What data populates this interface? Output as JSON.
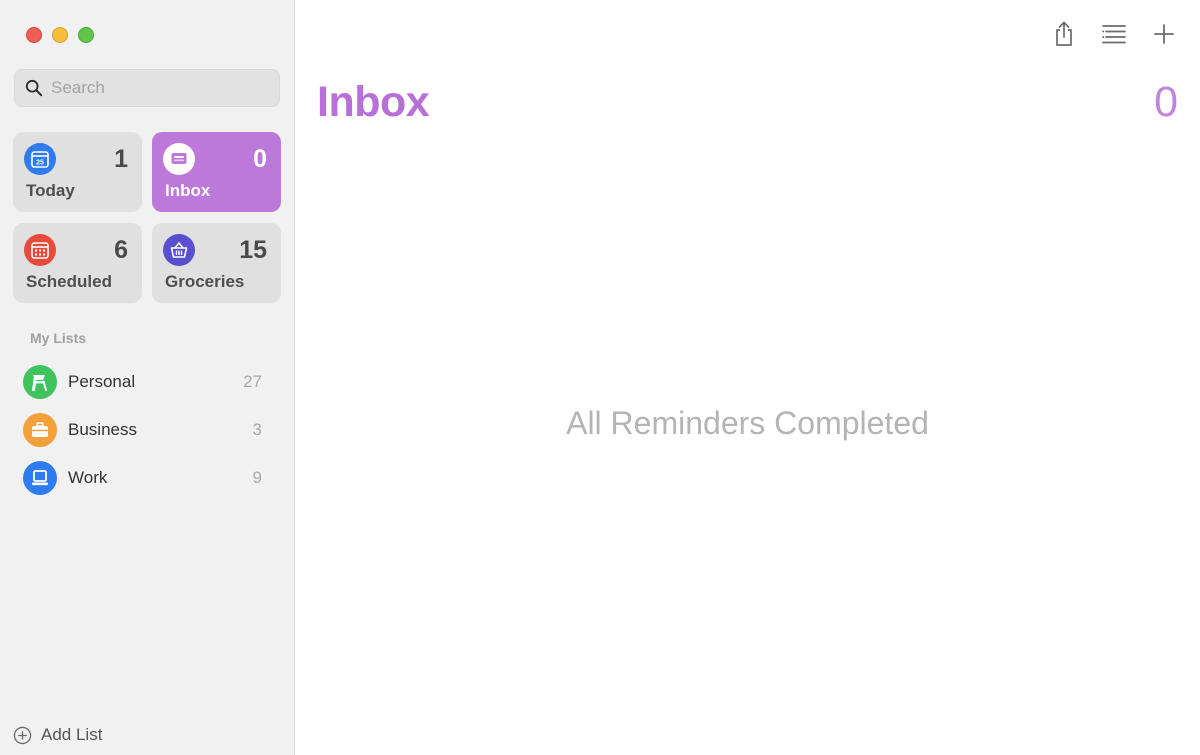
{
  "colors": {
    "accent": "#bd79d9",
    "title": "#b96fd8",
    "today_icon": "#2f7bf0",
    "inbox_icon": "#ffffff",
    "scheduled_icon": "#e64a3b",
    "groceries_icon": "#5a4fcf",
    "personal_icon": "#3fc35d",
    "business_icon": "#f2a03a",
    "work_icon": "#2f7bf0"
  },
  "search": {
    "placeholder": "Search",
    "icon": "magnifier-icon"
  },
  "smart_lists": [
    {
      "label": "Today",
      "count": "1",
      "icon": "calendar-today-icon",
      "selected": false
    },
    {
      "label": "Inbox",
      "count": "0",
      "icon": "inbox-tray-icon",
      "selected": true
    },
    {
      "label": "Scheduled",
      "count": "6",
      "icon": "calendar-grid-icon",
      "selected": false
    },
    {
      "label": "Groceries",
      "count": "15",
      "icon": "basket-icon",
      "selected": false
    }
  ],
  "my_lists": {
    "title": "My Lists",
    "items": [
      {
        "name": "Personal",
        "count": "27",
        "icon": "chair-icon"
      },
      {
        "name": "Business",
        "count": "3",
        "icon": "briefcase-icon"
      },
      {
        "name": "Work",
        "count": "9",
        "icon": "laptop-icon"
      }
    ]
  },
  "footer": {
    "add_list_label": "Add List",
    "icon": "plus-circle-icon"
  },
  "main": {
    "title": "Inbox",
    "count": "0",
    "empty_message": "All Reminders Completed",
    "toolbar": [
      "share-icon",
      "list-options-icon",
      "plus-icon"
    ]
  }
}
